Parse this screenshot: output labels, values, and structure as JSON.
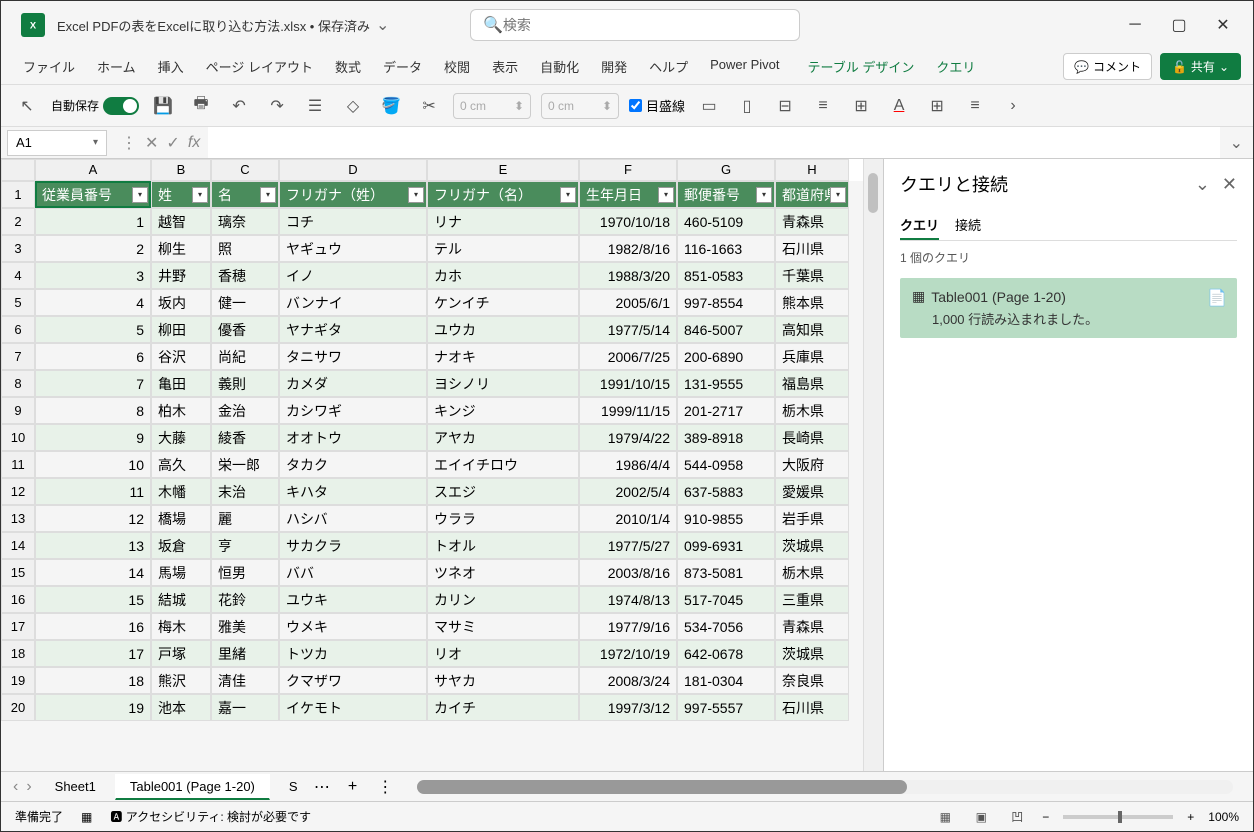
{
  "title": "Excel PDFの表をExcelに取り込む方法.xlsx • 保存済み",
  "search_placeholder": "検索",
  "ribbon_tabs": [
    "ファイル",
    "ホーム",
    "挿入",
    "ページ レイアウト",
    "数式",
    "データ",
    "校閲",
    "表示",
    "自動化",
    "開発",
    "ヘルプ",
    "Power Pivot"
  ],
  "contextual_tabs": [
    "テーブル デザイン",
    "クエリ"
  ],
  "comment_btn": "コメント",
  "share_btn": "共有",
  "autosave_label": "自動保存",
  "autosave_on": "オン",
  "dim1": "0 cm",
  "dim2": "0 cm",
  "ruler_label": "目盛線",
  "name_box": "A1",
  "columns": [
    {
      "letter": "A",
      "width": 116
    },
    {
      "letter": "B",
      "width": 60
    },
    {
      "letter": "C",
      "width": 68
    },
    {
      "letter": "D",
      "width": 148
    },
    {
      "letter": "E",
      "width": 152
    },
    {
      "letter": "F",
      "width": 98
    },
    {
      "letter": "G",
      "width": 98
    },
    {
      "letter": "H",
      "width": 74
    }
  ],
  "headers": [
    "従業員番号",
    "姓",
    "名",
    "フリガナ（姓）",
    "フリガナ（名）",
    "生年月日",
    "郵便番号",
    "都道府県"
  ],
  "rows": [
    [
      "1",
      "越智",
      "璃奈",
      "コチ",
      "リナ",
      "1970/10/18",
      "460-5109",
      "青森県"
    ],
    [
      "2",
      "柳生",
      "照",
      "ヤギュウ",
      "テル",
      "1982/8/16",
      "116-1663",
      "石川県"
    ],
    [
      "3",
      "井野",
      "香穂",
      "イノ",
      "カホ",
      "1988/3/20",
      "851-0583",
      "千葉県"
    ],
    [
      "4",
      "坂内",
      "健一",
      "バンナイ",
      "ケンイチ",
      "2005/6/1",
      "997-8554",
      "熊本県"
    ],
    [
      "5",
      "柳田",
      "優香",
      "ヤナギタ",
      "ユウカ",
      "1977/5/14",
      "846-5007",
      "高知県"
    ],
    [
      "6",
      "谷沢",
      "尚紀",
      "タニサワ",
      "ナオキ",
      "2006/7/25",
      "200-6890",
      "兵庫県"
    ],
    [
      "7",
      "亀田",
      "義則",
      "カメダ",
      "ヨシノリ",
      "1991/10/15",
      "131-9555",
      "福島県"
    ],
    [
      "8",
      "柏木",
      "金治",
      "カシワギ",
      "キンジ",
      "1999/11/15",
      "201-2717",
      "栃木県"
    ],
    [
      "9",
      "大藤",
      "綾香",
      "オオトウ",
      "アヤカ",
      "1979/4/22",
      "389-8918",
      "長崎県"
    ],
    [
      "10",
      "高久",
      "栄一郎",
      "タカク",
      "エイイチロウ",
      "1986/4/4",
      "544-0958",
      "大阪府"
    ],
    [
      "11",
      "木幡",
      "末治",
      "キハタ",
      "スエジ",
      "2002/5/4",
      "637-5883",
      "愛媛県"
    ],
    [
      "12",
      "橋場",
      "麗",
      "ハシバ",
      "ウララ",
      "2010/1/4",
      "910-9855",
      "岩手県"
    ],
    [
      "13",
      "坂倉",
      "亨",
      "サカクラ",
      "トオル",
      "1977/5/27",
      "099-6931",
      "茨城県"
    ],
    [
      "14",
      "馬場",
      "恒男",
      "ババ",
      "ツネオ",
      "2003/8/16",
      "873-5081",
      "栃木県"
    ],
    [
      "15",
      "結城",
      "花鈴",
      "ユウキ",
      "カリン",
      "1974/8/13",
      "517-7045",
      "三重県"
    ],
    [
      "16",
      "梅木",
      "雅美",
      "ウメキ",
      "マサミ",
      "1977/9/16",
      "534-7056",
      "青森県"
    ],
    [
      "17",
      "戸塚",
      "里緒",
      "トツカ",
      "リオ",
      "1972/10/19",
      "642-0678",
      "茨城県"
    ],
    [
      "18",
      "熊沢",
      "清佳",
      "クマザワ",
      "サヤカ",
      "2008/3/24",
      "181-0304",
      "奈良県"
    ],
    [
      "19",
      "池本",
      "嘉一",
      "イケモト",
      "カイチ",
      "1997/3/12",
      "997-5557",
      "石川県"
    ]
  ],
  "query_pane": {
    "title": "クエリと接続",
    "tab_query": "クエリ",
    "tab_conn": "接続",
    "count": "1 個のクエリ",
    "item_name": "Table001 (Page 1-20)",
    "item_status": "1,000 行読み込まれました。"
  },
  "sheets": {
    "sheet1": "Sheet1",
    "active": "Table001 (Page 1-20)",
    "trunc": "S"
  },
  "status": {
    "ready": "準備完了",
    "a11y": "アクセシビリティ: 検討が必要です",
    "zoom": "100%"
  }
}
